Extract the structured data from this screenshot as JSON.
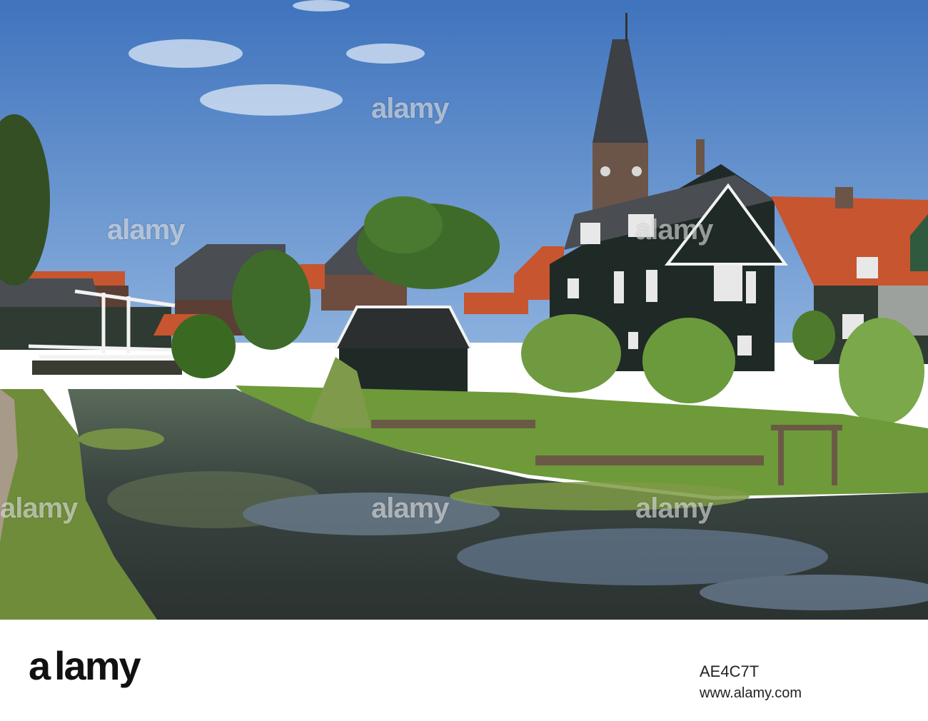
{
  "photo": {
    "colors": {
      "sky": "#4d7fc4",
      "sky_light": "#8db3e2",
      "water": "#3c4640",
      "house_dark": "#1f2a27",
      "roof_orange": "#c7552f",
      "roof_slate": "#4a4d52",
      "grass": "#6e9a3a",
      "tree": "#3f6b2a",
      "tower_brick": "#6b5548"
    }
  },
  "watermark": {
    "text": "alamy"
  },
  "footer": {
    "logo_text": "alamy",
    "image_id": "AE4C7T",
    "site": "www.alamy.com"
  }
}
